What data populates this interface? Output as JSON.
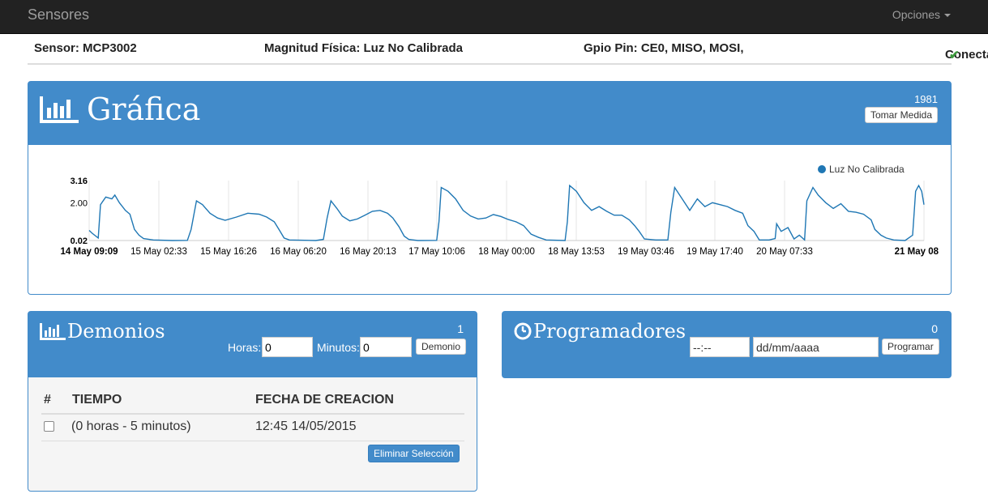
{
  "navbar": {
    "brand": "Sensores",
    "options_label": "Opciones"
  },
  "info": {
    "sensor": "Sensor: MCP3002",
    "magnitud": "Magnitud Física: Luz No Calibrada",
    "gpio": "Gpio Pin: CE0, MISO, MOSI,",
    "conectado": "Conectado:",
    "check_icon": "✔"
  },
  "grafica": {
    "title": "Gráfica",
    "count": "1981",
    "button_label": "Tomar Medida"
  },
  "chart_data": {
    "type": "line",
    "legend": [
      "Luz No Calibrada"
    ],
    "legend_position": "top-right",
    "y_ticks": [
      "0.02",
      "2.00",
      "3.16"
    ],
    "ylim": [
      0.02,
      3.16
    ],
    "x_ticks": [
      "14 May 09:09",
      "15 May 02:33",
      "15 May 16:26",
      "16 May 06:20",
      "16 May 20:13",
      "17 May 10:06",
      "18 May 00:00",
      "18 May 13:53",
      "19 May 03:46",
      "19 May 17:40",
      "20 May 07:33",
      "21 May 08"
    ],
    "grid": "vertical",
    "series_color": "#1f77b4",
    "series": [
      {
        "name": "Luz No Calibrada",
        "points": [
          [
            0,
            0.55
          ],
          [
            0.4,
            0.4
          ],
          [
            1.2,
            0.15
          ],
          [
            1.5,
            1.9
          ],
          [
            2.2,
            2.3
          ],
          [
            3.0,
            2.2
          ],
          [
            3.4,
            2.4
          ],
          [
            4.0,
            2.0
          ],
          [
            4.8,
            1.6
          ],
          [
            5.4,
            1.4
          ],
          [
            6.0,
            0.6
          ],
          [
            6.6,
            0.3
          ],
          [
            7.2,
            0.12
          ],
          [
            8.5,
            0.05
          ],
          [
            11.0,
            0.02
          ],
          [
            13.0,
            0.03
          ],
          [
            13.5,
            0.6
          ],
          [
            14.2,
            2.1
          ],
          [
            15.0,
            1.9
          ],
          [
            16.0,
            1.45
          ],
          [
            17.0,
            1.2
          ],
          [
            18.0,
            1.08
          ],
          [
            19.5,
            1.25
          ],
          [
            21.0,
            1.45
          ],
          [
            22.5,
            1.4
          ],
          [
            23.5,
            1.25
          ],
          [
            24.5,
            1.0
          ],
          [
            25.2,
            0.55
          ],
          [
            25.8,
            0.15
          ],
          [
            26.5,
            0.05
          ],
          [
            30.0,
            0.02
          ],
          [
            31.0,
            0.08
          ],
          [
            31.5,
            1.2
          ],
          [
            32.0,
            2.1
          ],
          [
            32.8,
            1.7
          ],
          [
            33.5,
            1.3
          ],
          [
            34.5,
            1.05
          ],
          [
            35.5,
            1.15
          ],
          [
            36.5,
            1.35
          ],
          [
            37.5,
            1.55
          ],
          [
            38.5,
            1.6
          ],
          [
            39.5,
            1.45
          ],
          [
            40.2,
            1.2
          ],
          [
            41.0,
            0.75
          ],
          [
            41.7,
            0.25
          ],
          [
            42.3,
            0.08
          ],
          [
            43.5,
            0.02
          ],
          [
            46.0,
            0.03
          ],
          [
            46.3,
            1.0
          ],
          [
            46.6,
            2.8
          ],
          [
            47.5,
            2.6
          ],
          [
            48.5,
            2.2
          ],
          [
            49.5,
            1.6
          ],
          [
            50.5,
            1.3
          ],
          [
            51.5,
            1.15
          ],
          [
            52.5,
            1.2
          ],
          [
            53.5,
            1.38
          ],
          [
            54.5,
            1.28
          ],
          [
            55.5,
            1.12
          ],
          [
            56.5,
            1.0
          ],
          [
            57.5,
            0.8
          ],
          [
            58.5,
            0.35
          ],
          [
            59.5,
            0.18
          ],
          [
            60.5,
            0.05
          ],
          [
            63.0,
            0.02
          ],
          [
            63.3,
            1.0
          ],
          [
            63.6,
            2.9
          ],
          [
            64.5,
            2.6
          ],
          [
            65.5,
            2.0
          ],
          [
            66.5,
            1.6
          ],
          [
            67.5,
            1.8
          ],
          [
            68.5,
            1.55
          ],
          [
            69.5,
            1.35
          ],
          [
            70.5,
            1.35
          ],
          [
            71.5,
            1.1
          ],
          [
            72.2,
            0.8
          ],
          [
            72.8,
            0.5
          ],
          [
            73.5,
            0.1
          ],
          [
            75.0,
            0.05
          ],
          [
            76.6,
            0.05
          ],
          [
            77.0,
            1.5
          ],
          [
            77.5,
            2.8
          ],
          [
            78.5,
            2.2
          ],
          [
            79.5,
            1.6
          ],
          [
            80.5,
            2.2
          ],
          [
            81.5,
            1.8
          ],
          [
            82.5,
            2.0
          ],
          [
            83.5,
            1.9
          ],
          [
            84.5,
            1.8
          ],
          [
            85.5,
            1.6
          ],
          [
            86.5,
            1.45
          ],
          [
            87.2,
            0.8
          ],
          [
            88.0,
            0.5
          ],
          [
            88.7,
            0.05
          ],
          [
            90.0,
            0.05
          ],
          [
            90.8,
            0.12
          ],
          [
            91.0,
            0.9
          ],
          [
            91.6,
            0.5
          ],
          [
            92.5,
            0.7
          ],
          [
            93.3,
            0.1
          ],
          [
            94.0,
            0.3
          ],
          [
            94.7,
            0.05
          ],
          [
            95.0,
            2.1
          ],
          [
            95.8,
            2.8
          ],
          [
            96.5,
            2.4
          ],
          [
            97.5,
            2.0
          ],
          [
            98.5,
            1.7
          ],
          [
            99.5,
            1.95
          ],
          [
            100.5,
            1.55
          ],
          [
            101.5,
            1.5
          ],
          [
            102.5,
            1.4
          ],
          [
            103.5,
            1.1
          ],
          [
            104.0,
            0.6
          ],
          [
            104.8,
            0.3
          ],
          [
            105.5,
            0.15
          ],
          [
            106.5,
            0.05
          ],
          [
            108.0,
            0.02
          ],
          [
            109.0,
            0.3
          ],
          [
            109.4,
            2.6
          ],
          [
            109.8,
            2.9
          ],
          [
            110.2,
            2.6
          ],
          [
            110.5,
            1.9
          ]
        ]
      }
    ]
  },
  "demonios": {
    "title": "Demonios",
    "count": "1",
    "horas_label": "Horas:",
    "horas_value": "0",
    "minutos_label": "Minutos:",
    "minutos_value": "0",
    "button_label": "Demonio",
    "table_headers": [
      "#",
      "TIEMPO",
      "FECHA DE CREACION"
    ],
    "rows": [
      {
        "tiempo": "(0 horas - 5 minutos)",
        "fecha": "12:45 14/05/2015"
      }
    ],
    "delete_button": "Eliminar Selección"
  },
  "programadores": {
    "title": "Programadores",
    "count": "0",
    "time_placeholder": "--:--",
    "date_placeholder": "dd/mm/aaaa",
    "button_label": "Programar"
  }
}
